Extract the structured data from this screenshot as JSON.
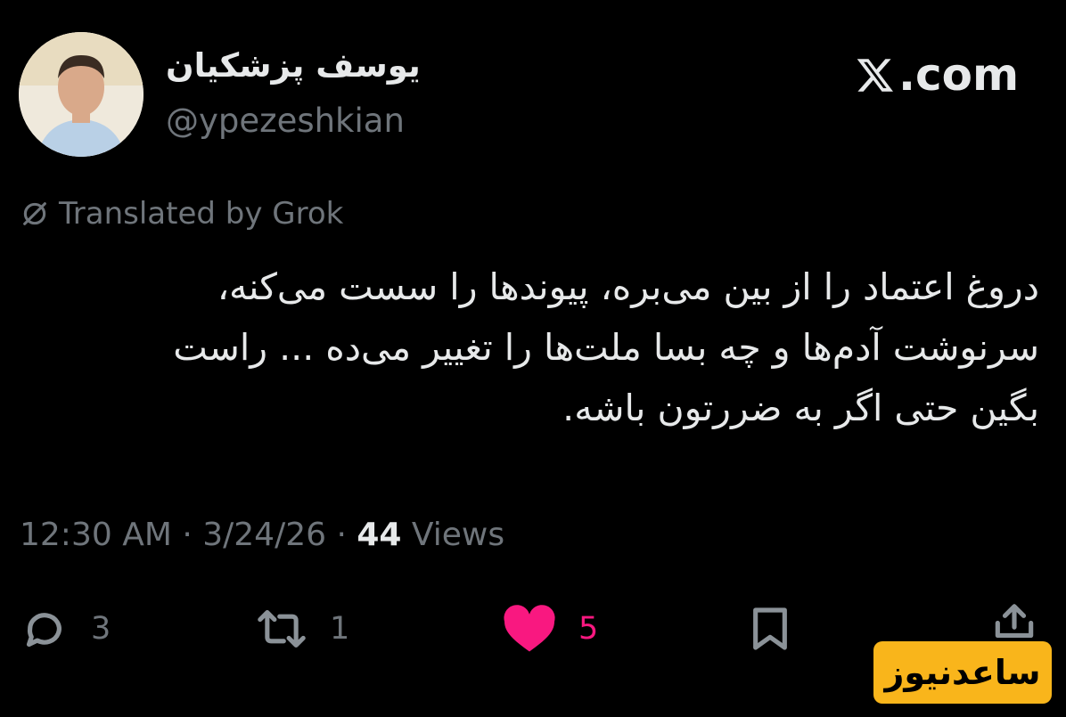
{
  "profile": {
    "display_name": "یوسف پزشکیان",
    "handle": "@ypezeshkian",
    "avatar_icon": "profile-photo"
  },
  "brand": {
    "label": ".com",
    "icon": "x-logo-icon"
  },
  "translation": {
    "label": "Translated by Grok",
    "icon": "grok-icon"
  },
  "tweet": {
    "lines": [
      "دروغ اعتماد را از بین می‌بره، پیوندها را سست می‌کنه،",
      "سرنوشت آدم‌ها و چه بسا ملت‌ها را تغییر می‌ده ... راست",
      "بگین حتی اگر به ضررتون باشه."
    ]
  },
  "meta": {
    "time": "12:30 AM",
    "separator": " · ",
    "date": "3/24/26",
    "views_count": "44",
    "views_label": "Views"
  },
  "actions": {
    "replies": "3",
    "reposts": "1",
    "likes": "5",
    "like_color": "#f91880"
  },
  "watermark": {
    "text": "ساعدنیوز",
    "color": "#f9b51b"
  }
}
